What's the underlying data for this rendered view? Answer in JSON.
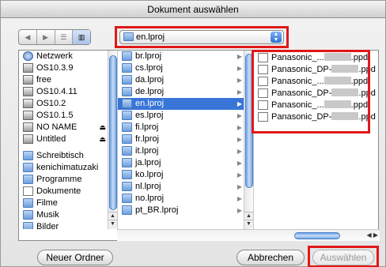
{
  "window": {
    "title": "Dokument auswählen"
  },
  "toolbar": {
    "back_icon": "back-arrow-icon",
    "forward_icon": "forward-arrow-icon",
    "view_list_icon": "list-view-icon",
    "view_column_icon": "column-view-icon",
    "location": "en.lproj"
  },
  "sidebar": {
    "devices": [
      {
        "label": "Netzwerk",
        "icon": "network-icon"
      },
      {
        "label": "OS10.3.9",
        "icon": "disk-icon"
      },
      {
        "label": "free",
        "icon": "disk-icon"
      },
      {
        "label": "OS10.4.11",
        "icon": "disk-icon"
      },
      {
        "label": "OS10.2",
        "icon": "disk-icon"
      },
      {
        "label": "OS10.1.5",
        "icon": "disk-icon"
      },
      {
        "label": "NO NAME",
        "icon": "disk-icon"
      },
      {
        "label": "Untitled",
        "icon": "disk-icon"
      }
    ],
    "places": [
      {
        "label": "Schreibtisch",
        "icon": "desktop-icon"
      },
      {
        "label": "kenichimatuzaki",
        "icon": "home-icon"
      },
      {
        "label": "Programme",
        "icon": "applications-icon"
      },
      {
        "label": "Dokumente",
        "icon": "documents-icon"
      },
      {
        "label": "Filme",
        "icon": "movies-icon"
      },
      {
        "label": "Musik",
        "icon": "music-icon"
      },
      {
        "label": "Bilder",
        "icon": "pictures-icon"
      }
    ]
  },
  "folders": [
    {
      "label": "br.lproj",
      "selected": false
    },
    {
      "label": "cs.lproj",
      "selected": false
    },
    {
      "label": "da.lproj",
      "selected": false
    },
    {
      "label": "de.lproj",
      "selected": false
    },
    {
      "label": "en.lproj",
      "selected": true
    },
    {
      "label": "es.lproj",
      "selected": false
    },
    {
      "label": "fi.lproj",
      "selected": false
    },
    {
      "label": "fr.lproj",
      "selected": false
    },
    {
      "label": "it.lproj",
      "selected": false
    },
    {
      "label": "ja.lproj",
      "selected": false
    },
    {
      "label": "ko.lproj",
      "selected": false
    },
    {
      "label": "nl.lproj",
      "selected": false
    },
    {
      "label": "no.lproj",
      "selected": false
    },
    {
      "label": "pt_BR.lproj",
      "selected": false
    }
  ],
  "files": [
    {
      "prefix": "Panasonic_...",
      "suffix": ".ppd"
    },
    {
      "prefix": "Panasonic_DP-",
      "suffix": ".ppd"
    },
    {
      "prefix": "Panasonic_...",
      "suffix": ".ppd"
    },
    {
      "prefix": "Panasonic_DP-",
      "suffix": ".ppd"
    },
    {
      "prefix": "Panasonic_...",
      "suffix": ".ppd"
    },
    {
      "prefix": "Panasonic_DP-",
      "suffix": ".ppd"
    }
  ],
  "buttons": {
    "new_folder": "Neuer Ordner",
    "cancel": "Abbrechen",
    "choose": "Auswählen"
  },
  "colors": {
    "selection": "#3875d7",
    "highlight": "#e01818"
  }
}
